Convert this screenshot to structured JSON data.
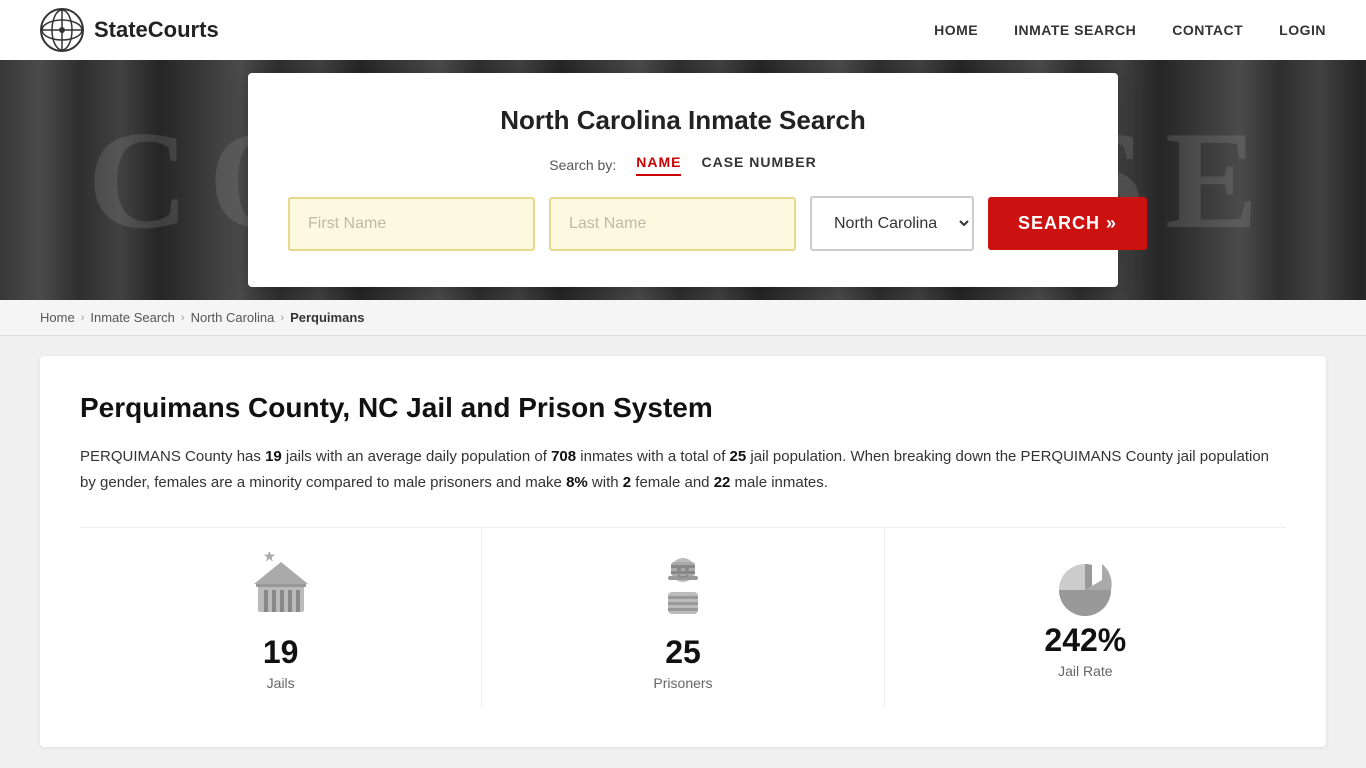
{
  "header": {
    "logo_text": "StateCourts",
    "nav": {
      "home": "HOME",
      "inmate_search": "INMATE SEARCH",
      "contact": "CONTACT",
      "login": "LOGIN"
    }
  },
  "hero": {
    "bg_text": "COURTHOUSE"
  },
  "search_card": {
    "title": "North Carolina Inmate Search",
    "search_by_label": "Search by:",
    "tab_name": "NAME",
    "tab_case": "CASE NUMBER",
    "first_name_placeholder": "First Name",
    "last_name_placeholder": "Last Name",
    "state_value": "North Carolina",
    "search_button": "SEARCH »"
  },
  "breadcrumb": {
    "home": "Home",
    "inmate_search": "Inmate Search",
    "state": "North Carolina",
    "current": "Perquimans"
  },
  "main": {
    "title": "Perquimans County, NC Jail and Prison System",
    "description_part1": "PERQUIMANS County has ",
    "jails_count": "19",
    "description_part2": " jails with an average daily population of ",
    "avg_population": "708",
    "description_part3": " inmates with a total of ",
    "total_population": "25",
    "description_part4": " jail population. When breaking down the PERQUIMANS County jail population by gender, females are a minority compared to male prisoners and make ",
    "female_pct": "8%",
    "description_part5": " with ",
    "female_count": "2",
    "description_part6": " female and ",
    "male_count": "22",
    "description_part7": " male inmates.",
    "stats": [
      {
        "number": "19",
        "label": "Jails",
        "icon": "jail-icon"
      },
      {
        "number": "25",
        "label": "Prisoners",
        "icon": "prisoner-icon"
      },
      {
        "number": "242%",
        "label": "Jail Rate",
        "icon": "pie-chart-icon"
      }
    ]
  }
}
